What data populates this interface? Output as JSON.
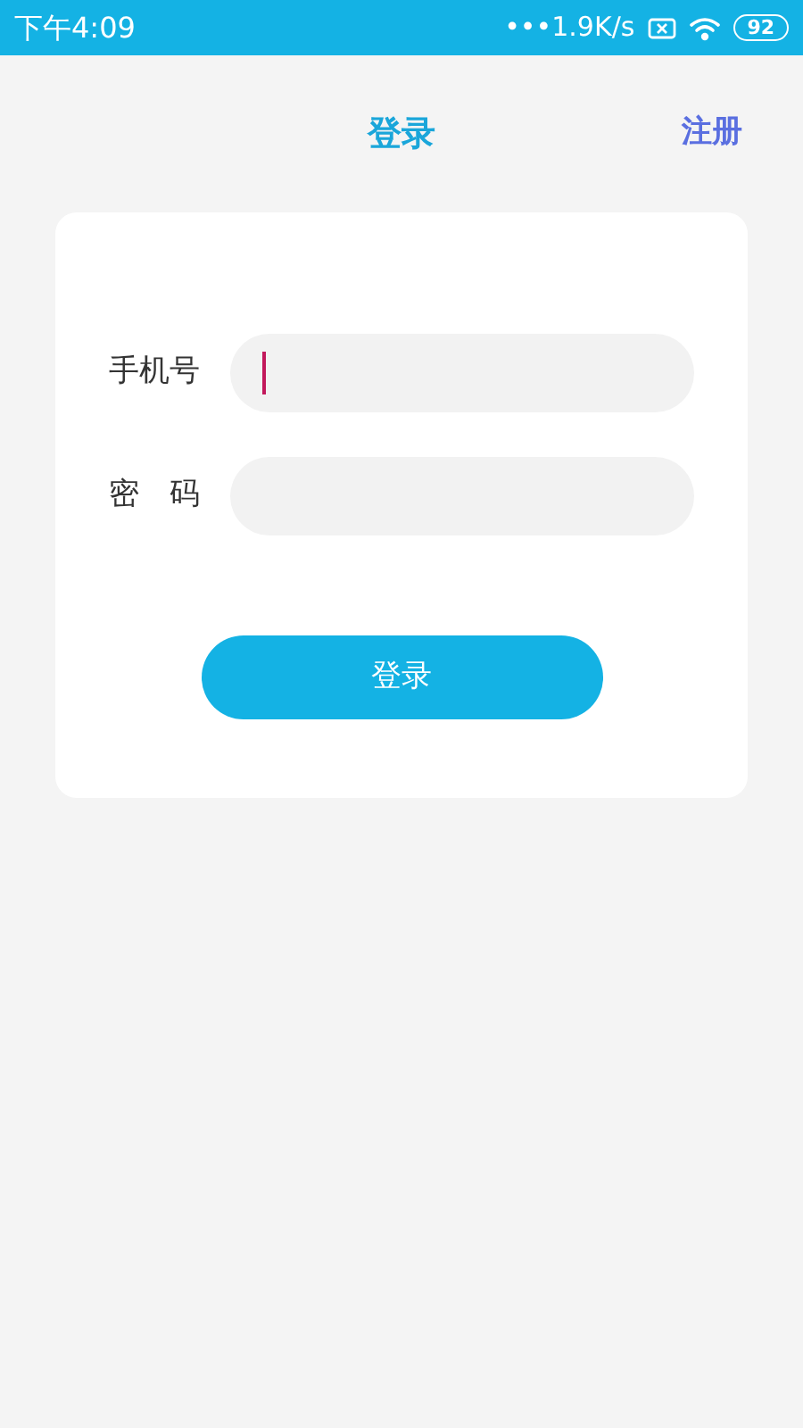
{
  "status_bar": {
    "time": "下午4:09",
    "speed": "•••1.9K/s",
    "battery": "92"
  },
  "header": {
    "title": "登录",
    "action": "注册"
  },
  "form": {
    "fields": [
      {
        "label": "手机号",
        "focused": true
      },
      {
        "label": "密　码",
        "focused": false
      }
    ],
    "submit": "登录"
  }
}
